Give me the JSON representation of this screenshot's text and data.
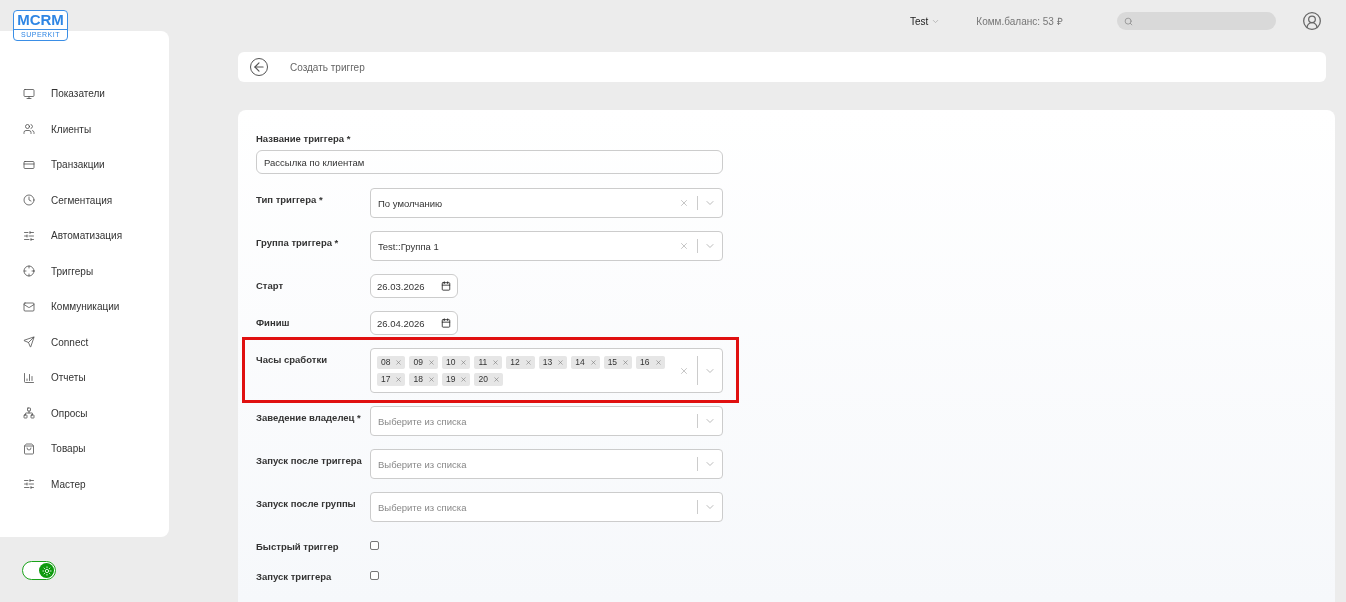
{
  "logo": {
    "title": "MCRM",
    "subtitle": "SUPERKIT"
  },
  "sidebar": {
    "items": [
      {
        "label": "Показатели"
      },
      {
        "label": "Клиенты"
      },
      {
        "label": "Транзакции"
      },
      {
        "label": "Сегментация"
      },
      {
        "label": "Автоматизация"
      },
      {
        "label": "Триггеры"
      },
      {
        "label": "Коммуникации"
      },
      {
        "label": "Connect"
      },
      {
        "label": "Отчеты"
      },
      {
        "label": "Опросы"
      },
      {
        "label": "Товары"
      },
      {
        "label": "Мастер"
      }
    ]
  },
  "theme_toggle": {
    "on": true
  },
  "header": {
    "account": "Test",
    "balance": "Комм.баланс: 53 ₽"
  },
  "breadcrumb": {
    "title": "Создать триггер"
  },
  "form": {
    "name_field": {
      "label": "Название триггера *",
      "value": "Рассылка по клиентам"
    },
    "fields": [
      {
        "kind": "select",
        "label": "Тип триггера *",
        "value": "По умолчанию",
        "clearable": true
      },
      {
        "kind": "select",
        "label": "Группа триггера *",
        "value": "Test::Группа 1",
        "clearable": true
      },
      {
        "kind": "date",
        "label": "Старт",
        "value": "26.03.2026"
      },
      {
        "kind": "date",
        "label": "Финиш",
        "value": "26.04.2026"
      },
      {
        "kind": "tags",
        "label": "Часы сработки",
        "clearable": true,
        "highlighted": true,
        "tags": [
          "08",
          "09",
          "10",
          "11",
          "12",
          "13",
          "14",
          "15",
          "16",
          "17",
          "18",
          "19",
          "20"
        ]
      },
      {
        "kind": "select",
        "label": "Заведение владелец *",
        "placeholder": "Выберите из списка",
        "clearable": false
      },
      {
        "kind": "select",
        "label": "Запуск после триггера",
        "placeholder": "Выберите из списка",
        "clearable": false
      },
      {
        "kind": "select",
        "label": "Запуск после группы",
        "placeholder": "Выберите из списка",
        "clearable": false
      },
      {
        "kind": "checkbox",
        "label": "Быстрый триггер",
        "checked": false
      },
      {
        "kind": "checkbox",
        "label": "Запуск триггера",
        "checked": false
      }
    ]
  }
}
